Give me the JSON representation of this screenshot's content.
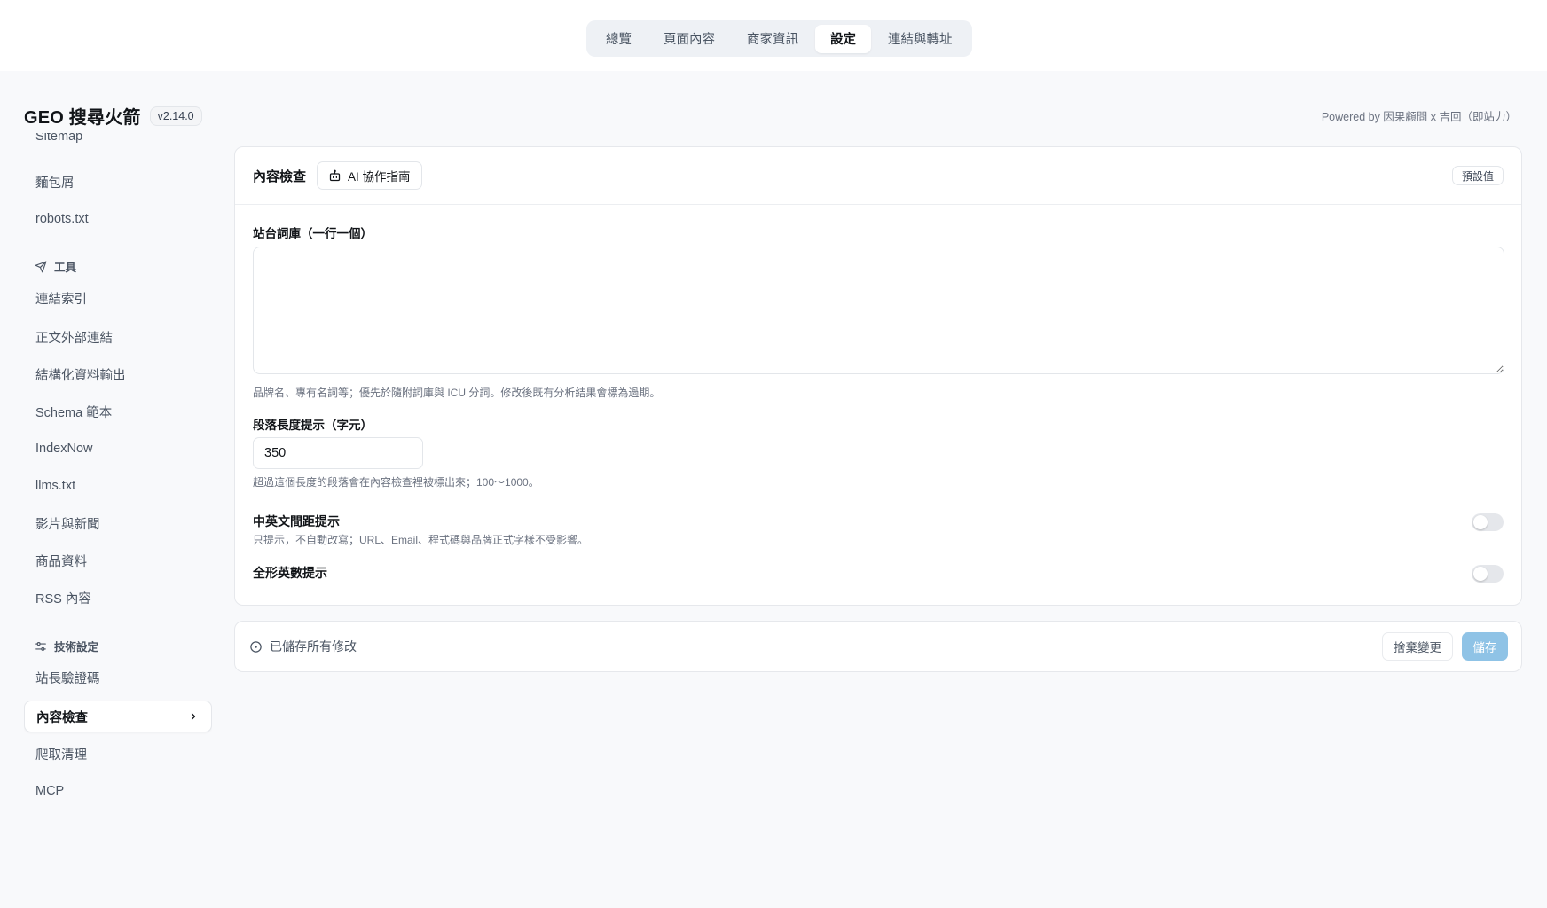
{
  "topnav": {
    "tabs": [
      {
        "label": "總覽"
      },
      {
        "label": "頁面內容"
      },
      {
        "label": "商家資訊"
      },
      {
        "label": "設定"
      },
      {
        "label": "連結與轉址"
      }
    ],
    "active_tab": "設定"
  },
  "brand": {
    "title": "GEO 搜尋火箭",
    "version": "v2.14.0",
    "powered_by": "Powered by 因果顧問 x 吉回（即站力）"
  },
  "sidebar": {
    "items_top": [
      {
        "label": "Sitemap"
      },
      {
        "label": "麵包屑"
      },
      {
        "label": "robots.txt"
      }
    ],
    "section_tools": {
      "label": "工具",
      "icon": "send-icon"
    },
    "items_tools": [
      {
        "label": "連結索引"
      },
      {
        "label": "正文外部連結"
      },
      {
        "label": "結構化資料輸出"
      },
      {
        "label": "Schema 範本"
      },
      {
        "label": "IndexNow"
      },
      {
        "label": "llms.txt"
      },
      {
        "label": "影片與新聞"
      },
      {
        "label": "商品資料"
      },
      {
        "label": "RSS 內容"
      }
    ],
    "section_tech": {
      "label": "技術設定",
      "icon": "sliders-icon"
    },
    "items_tech": [
      {
        "label": "站長驗證碼"
      },
      {
        "label": "內容檢查"
      },
      {
        "label": "爬取清理"
      },
      {
        "label": "MCP"
      }
    ],
    "active_item": "內容檢查"
  },
  "card": {
    "title": "內容檢查",
    "ai_button": "AI 協作指南",
    "default_button": "預設值",
    "dictionary_label": "站台詞庫（一行一個）",
    "dictionary_value": "",
    "dictionary_hint": "品牌名、專有名詞等；優先於隨附詞庫與 ICU 分詞。修改後既有分析結果會標為過期。",
    "length_label": "段落長度提示（字元）",
    "length_value": "350",
    "length_hint": "超過這個長度的段落會在內容檢查裡被標出來；100〜1000。",
    "spacing_label": "中英文間距提示",
    "spacing_hint": "只提示，不自動改寫；URL、Email、程式碼與品牌正式字樣不受影響。",
    "spacing_enabled": false,
    "fullwidth_label": "全形英數提示",
    "fullwidth_enabled": false
  },
  "savebar": {
    "status": "已儲存所有修改",
    "discard": "捨棄變更",
    "save": "儲存"
  },
  "colors": {
    "accent_disabled": "#8fc3e6",
    "background": "#f8f9fb"
  }
}
